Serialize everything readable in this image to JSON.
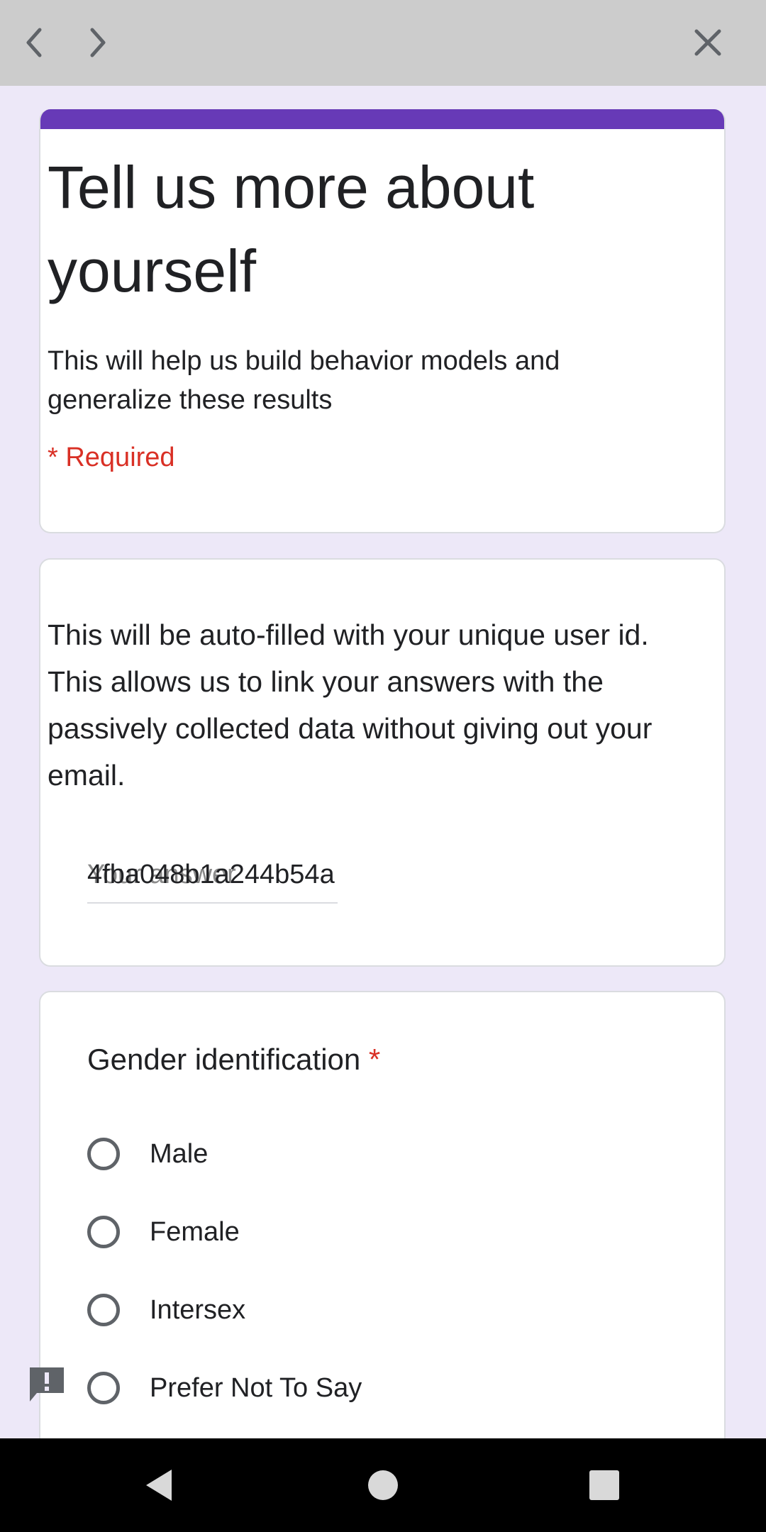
{
  "browser": {
    "back_icon": "chevron-left-icon",
    "forward_icon": "chevron-right-icon",
    "close_icon": "close-icon"
  },
  "form": {
    "accent_color": "#673ab7",
    "title": "Tell us more about yourself",
    "description": "This will help us build behavior models and generalize these results",
    "required_note": "* Required"
  },
  "user_id_question": {
    "description": "This will be auto-filled with your unique user id. This allows us to link your answers with the passively collected data without giving out your email.",
    "placeholder": "Your answer",
    "value": "4fba048b1a244b54a"
  },
  "gender_question": {
    "title": "Gender identification",
    "required_star": "*",
    "options": [
      {
        "label": "Male",
        "selected": false
      },
      {
        "label": "Female",
        "selected": false
      },
      {
        "label": "Intersex",
        "selected": false
      },
      {
        "label": "Prefer Not To Say",
        "selected": false
      }
    ]
  },
  "feedback_icon": "report-feedback-icon",
  "system_nav": {
    "back_icon": "nav-back-icon",
    "home_icon": "nav-home-icon",
    "recents_icon": "nav-recents-icon"
  }
}
